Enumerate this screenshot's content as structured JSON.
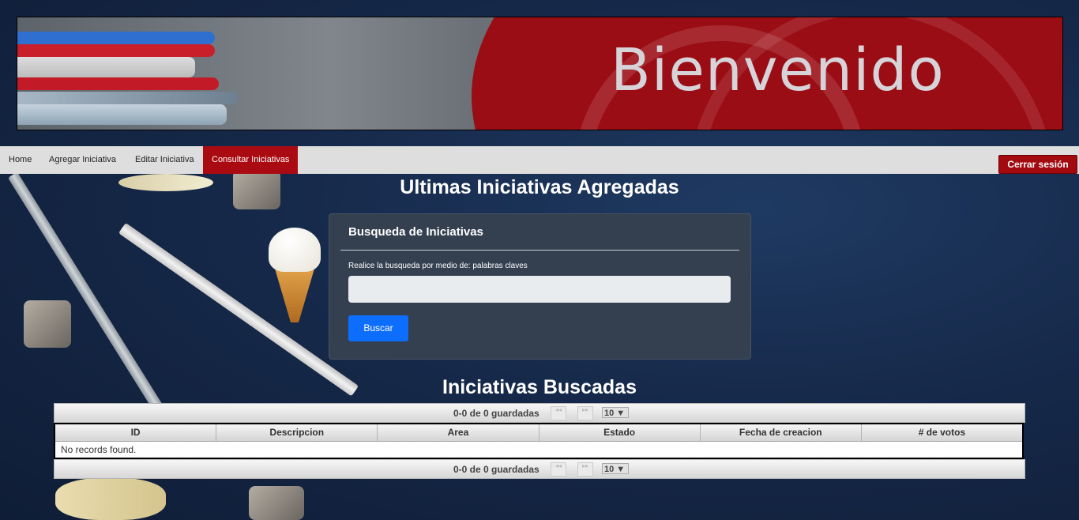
{
  "banner": {
    "title": "Bienvenido"
  },
  "nav": {
    "items": [
      {
        "label": "Home"
      },
      {
        "label": "Agregar Iniciativa"
      },
      {
        "label": "Editar Iniciativa"
      },
      {
        "label": "Consultar Iniciativas"
      }
    ],
    "active": "Consultar Iniciativas",
    "logout_label": "Cerrar sesión"
  },
  "main": {
    "heading": "Ultimas Iniciativas Agregadas",
    "search": {
      "title": "Busqueda de Iniciativas",
      "label": "Realice la busqueda por medio de: palabras claves",
      "value": "",
      "button_label": "Buscar"
    },
    "results": {
      "heading": "Iniciativas Buscadas",
      "pager_text": "0-0 de 0 guardadas",
      "page_size": "10 ▼",
      "columns": [
        "ID",
        "Descripcion",
        "Area",
        "Estado",
        "Fecha de creacion",
        "# de votos"
      ],
      "empty_message": "No records found."
    }
  },
  "colors": {
    "accent": "#aa0b12",
    "primary_button": "#0d6efd",
    "card_bg": "#343f50"
  }
}
